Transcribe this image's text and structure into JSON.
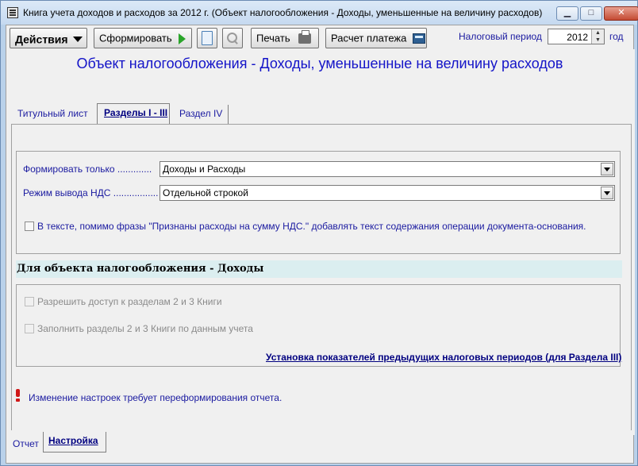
{
  "window": {
    "title": "Книга учета доходов и расходов за 2012 г. (Объект налогообложения - Доходы, уменьшенные на величину расходов)",
    "buttons": {
      "minimize": "▁",
      "maximize": "□",
      "close": "✕"
    }
  },
  "toolbar": {
    "actions_label": "Действия",
    "form_label": "Сформировать",
    "print_label": "Печать",
    "payment_label": "Расчет платежа",
    "period_label": "Налоговый период",
    "period_value": "2012",
    "year_label": "год"
  },
  "main": {
    "title": "Объект налогообложения - Доходы, уменьшенные на величину расходов"
  },
  "tabs": [
    {
      "label": "Титульный лист"
    },
    {
      "label": "Разделы I - III"
    },
    {
      "label": "Раздел IV"
    }
  ],
  "settings": {
    "form_only_label": "Формировать только .............",
    "form_only_value": "Доходы и Расходы",
    "vat_mode_label": "Режим вывода НДС .................",
    "vat_mode_value": "Отдельной строкой",
    "vat_text_checkbox": "В тексте, помимо фразы \"Признаны расходы на сумму НДС.\" добавлять текст содержания операции документа-основания.",
    "vat_text_checked": false
  },
  "income_section": {
    "header": "Для объекта налогообложения - Доходы",
    "allow_access_label": "Разрешить доступ к разделам 2 и 3 Книги",
    "allow_access_checked": false,
    "fill_sections_label": "Заполнить разделы 2 и 3 Книги по данным учета",
    "fill_sections_checked": false,
    "prev_periods_link": "Установка показателей предыдущих налоговых периодов (для Раздела III)"
  },
  "warning": {
    "text": "Изменение настроек требует переформирования отчета."
  },
  "bottom_tabs": [
    {
      "label": "Отчет"
    },
    {
      "label": "Настройка"
    }
  ],
  "colors": {
    "label_blue": "#1a1aa0",
    "title_blue": "#1414c8",
    "section_header_bg": "#dbeef0",
    "warning_red": "#d01818"
  }
}
